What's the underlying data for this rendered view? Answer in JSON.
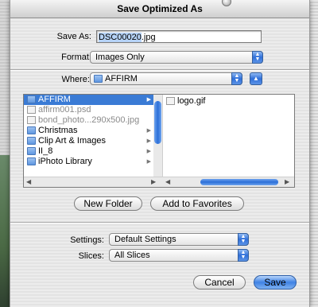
{
  "window": {
    "title": "Save Optimized As"
  },
  "save_as": {
    "label": "Save As:",
    "value_selected": "DSC00020",
    "value_rest": ".jpg"
  },
  "format": {
    "label": "Format:",
    "selected": "Images Only"
  },
  "where": {
    "label": "Where:",
    "selected": "AFFIRM"
  },
  "browser": {
    "column1": [
      {
        "name": "AFFIRM",
        "kind": "folder",
        "selected": true,
        "has_children": true
      },
      {
        "name": "affirm001.psd",
        "kind": "file",
        "dim": true,
        "has_children": false
      },
      {
        "name": "bond_photo...290x500.jpg",
        "kind": "file",
        "dim": true,
        "has_children": false
      },
      {
        "name": "Christmas",
        "kind": "folder",
        "selected": false,
        "has_children": true
      },
      {
        "name": "Clip Art & Images",
        "kind": "folder",
        "selected": false,
        "has_children": true
      },
      {
        "name": "II_8",
        "kind": "folder",
        "selected": false,
        "has_children": true
      },
      {
        "name": "iPhoto Library",
        "kind": "folder",
        "selected": false,
        "has_children": true
      }
    ],
    "column2": [
      {
        "name": "logo.gif",
        "kind": "file"
      }
    ]
  },
  "buttons": {
    "new_folder": "New Folder",
    "add_favorites": "Add to Favorites",
    "cancel": "Cancel",
    "save": "Save"
  },
  "settings": {
    "label": "Settings:",
    "selected": "Default Settings"
  },
  "slices": {
    "label": "Slices:",
    "selected": "All Slices"
  },
  "colors": {
    "accent": "#3a7bd5",
    "selection_text": "#b6d3f7"
  }
}
